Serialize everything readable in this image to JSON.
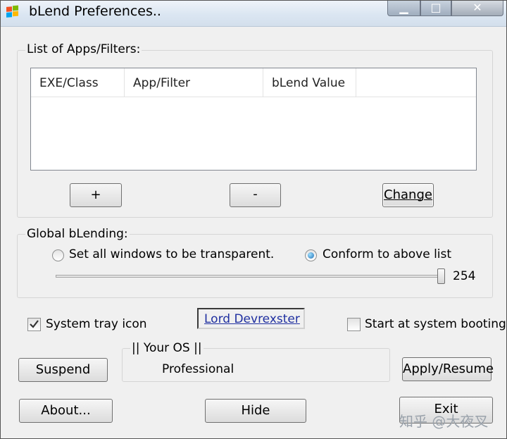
{
  "window": {
    "title": "bLend Preferences..",
    "buttons": {
      "minimize": "▁",
      "maximize": "□",
      "close": "✕"
    }
  },
  "list_group": {
    "label": "List of Apps/Filters:",
    "columns": [
      "EXE/Class",
      "App/Filter",
      "bLend Value"
    ],
    "rows": [],
    "add_label": "+",
    "remove_label": "-",
    "change_label": "Change"
  },
  "global_group": {
    "label": "Global bLending:",
    "option_all": "Set all windows to be transparent.",
    "option_conform": "Conform to above list",
    "selected": "option_conform",
    "slider_value": "254",
    "slider_fraction": 0.996
  },
  "options": {
    "tray_icon_label": "System tray icon",
    "tray_icon_checked": true,
    "author_link": "Lord Devrexster",
    "start_at_boot_label": "Start at system booting.",
    "start_at_boot_checked": false
  },
  "os_group": {
    "label": "|| Your OS ||",
    "value": "Professional"
  },
  "buttons": {
    "suspend": "Suspend",
    "apply": "Apply/Resume",
    "about": "About...",
    "hide": "Hide",
    "exit": "Exit"
  },
  "watermark": "知乎 @大夜叉",
  "colors": {
    "link": "#1f2fa0",
    "radio_dot": "#1f6fb5",
    "window_bg": "#f0f0f0"
  }
}
